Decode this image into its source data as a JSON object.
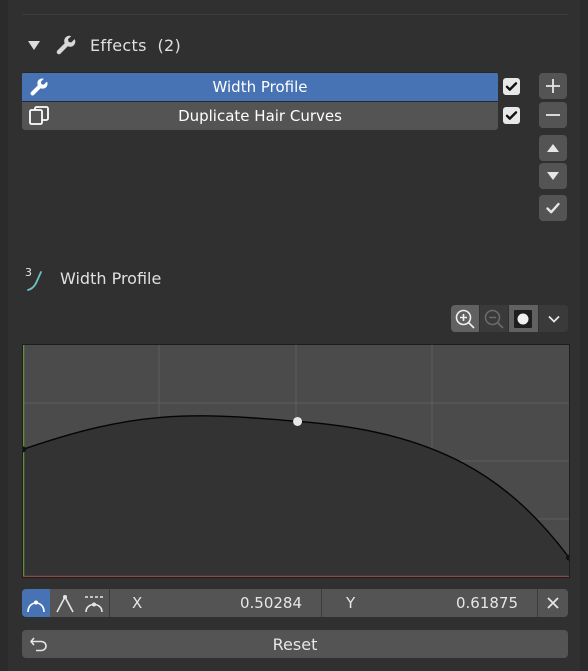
{
  "effects": {
    "title": "Effects",
    "count": "(2)"
  },
  "effect_list": [
    {
      "label": "Width Profile",
      "selected": true,
      "enabled": true,
      "icon": "wrench-icon"
    },
    {
      "label": "Duplicate Hair Curves",
      "selected": false,
      "enabled": true,
      "icon": "duplicate-icon"
    }
  ],
  "side_buttons": [
    "add-icon",
    "remove-icon",
    "move-up-icon",
    "move-down-icon",
    "apply-checkmark-icon"
  ],
  "width_profile": {
    "badge": "3",
    "title": "Width Profile"
  },
  "curve_tools": [
    "zoom-in-icon",
    "zoom-out-icon",
    "clip-toggle-icon",
    "chevron-down-icon"
  ],
  "curve": {
    "points": [
      [
        0.0,
        0.5
      ],
      [
        0.50284,
        0.61875
      ],
      [
        1.0,
        0.04
      ]
    ],
    "selected_index": 1
  },
  "handle_types": [
    "auto-handle-icon",
    "vector-handle-icon",
    "auto-clamped-handle-icon"
  ],
  "point_fields": {
    "x_label": "X",
    "x_value": "0.50284",
    "y_label": "Y",
    "y_value": "0.61875"
  },
  "reset": {
    "label": "Reset"
  },
  "colors": {
    "accent": "#4772b3",
    "button": "#545454",
    "panel": "#303030",
    "graph_bg": "#4b4b4b",
    "curve_fill": "#333333"
  }
}
